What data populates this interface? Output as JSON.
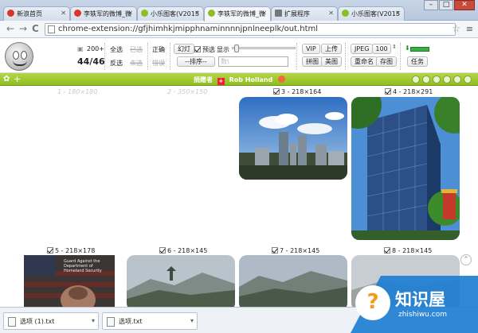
{
  "tabs": [
    {
      "label": "新浪首页",
      "color": "#d9362b",
      "active": false
    },
    {
      "label": "李轶军的微博_微",
      "color": "#d9362b",
      "active": false
    },
    {
      "label": "小乐图客(V2015",
      "color": "#8cbf27",
      "active": false
    },
    {
      "label": "李轶军的微博_微",
      "color": "#8cbf27",
      "active": true
    },
    {
      "label": "扩展程序",
      "color": "#777777",
      "active": false
    },
    {
      "label": "小乐图客(V2015",
      "color": "#8cbf27",
      "active": false
    }
  ],
  "window_buttons": {
    "minimize": "–",
    "maximize": "□",
    "close": "✕"
  },
  "address": {
    "url": "chrome-extension://gfjhimhkjmipphnaminnnnjpnlneeplk/out.html",
    "back": "←",
    "forward": "→",
    "reload": "C",
    "star": "☆",
    "menu": "≡"
  },
  "toolbar": {
    "min_size_value": "200+",
    "count": "44/46",
    "select_all": "全选",
    "invert": "反选",
    "selected_disabled": "已选",
    "unselected_disabled": "未选",
    "correct": "正确",
    "error_disabled": "错误",
    "slideshow": "幻灯",
    "preview": "预选",
    "display": "显示",
    "sort_placeholder": "--排序--",
    "search_placeholder": "数\\",
    "vip": "VIP",
    "upload": "上传",
    "stitch": "拼图",
    "beautify": "美图",
    "format": "JPEG",
    "quality": "100",
    "rename": "重命名",
    "save": "存图",
    "tasks": "任务"
  },
  "banner": {
    "credit_label": "捐赠者",
    "credit_name": "Rob Holland"
  },
  "thumbnails": [
    {
      "caption": "1 - 180×180",
      "faded": true,
      "checked": false
    },
    {
      "caption": "2 - 350×150",
      "faded": true,
      "checked": false
    },
    {
      "caption": "3 - 218×164",
      "faded": false,
      "checked": true
    },
    {
      "caption": "4 - 218×291",
      "faded": false,
      "checked": true
    },
    {
      "caption": "5 - 218×178",
      "faded": false,
      "checked": true
    },
    {
      "caption": "6 - 218×145",
      "faded": false,
      "checked": true
    },
    {
      "caption": "7 - 218×145",
      "faded": false,
      "checked": true
    },
    {
      "caption": "8 - 218×145",
      "faded": false,
      "checked": true
    }
  ],
  "photo5_text": "Guard Against the Department of Homeland Security",
  "downloads": [
    {
      "name": "选项 (1).txt"
    },
    {
      "name": "选项.txt"
    }
  ],
  "watermark": {
    "title": "知识屋",
    "sub": "zhishiwu.com",
    "icon": "?"
  }
}
